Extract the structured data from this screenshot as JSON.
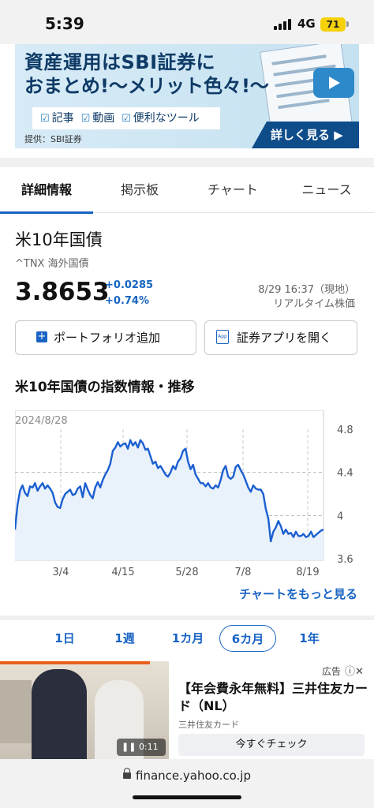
{
  "status_bar": {
    "time": "5:39",
    "network": "4G",
    "battery": "71"
  },
  "banner": {
    "line1": "資産運用はSBI証券に",
    "line2": "おまとめ!〜メリット色々!〜",
    "features": [
      "記事",
      "動画",
      "便利なツール"
    ],
    "cta": "詳しく見る ▶",
    "source": "提供：SBI証券"
  },
  "tabs": [
    "詳細情報",
    "掲示板",
    "チャート",
    "ニュース"
  ],
  "quote": {
    "name": "米10年国債",
    "symbol_line": "^TNX 海外国債",
    "price": "3.8653",
    "change": "+0.0285",
    "change_pct": "+0.74%",
    "timestamp": "8/29 16:37（現地）",
    "realtime": "リアルタイム株価"
  },
  "buttons": {
    "portfolio": "ポートフォリオ追加",
    "app": "証券アプリを開く"
  },
  "section_title": "米10年国債の指数情報・推移",
  "chart_data": {
    "type": "area",
    "start_label": "2024/8/28",
    "x_ticks": [
      "3/4",
      "4/15",
      "5/28",
      "7/8",
      "8/19"
    ],
    "y_ticks": [
      "4.8",
      "4.4",
      "4",
      "3.6"
    ],
    "ylim": [
      3.6,
      4.8
    ],
    "values": [
      3.87,
      4.1,
      4.23,
      4.28,
      4.21,
      4.18,
      4.27,
      4.26,
      4.3,
      4.23,
      4.27,
      4.3,
      4.25,
      4.28,
      4.25,
      4.21,
      4.12,
      4.08,
      4.07,
      4.15,
      4.2,
      4.22,
      4.24,
      4.19,
      4.2,
      4.25,
      4.27,
      4.17,
      4.3,
      4.24,
      4.19,
      4.16,
      4.26,
      4.31,
      4.26,
      4.33,
      4.38,
      4.42,
      4.48,
      4.6,
      4.63,
      4.68,
      4.64,
      4.66,
      4.67,
      4.62,
      4.7,
      4.65,
      4.68,
      4.63,
      4.7,
      4.67,
      4.61,
      4.62,
      4.55,
      4.48,
      4.5,
      4.44,
      4.46,
      4.42,
      4.38,
      4.36,
      4.4,
      4.46,
      4.43,
      4.5,
      4.53,
      4.6,
      4.62,
      4.5,
      4.43,
      4.47,
      4.38,
      4.34,
      4.3,
      4.3,
      4.27,
      4.3,
      4.26,
      4.25,
      4.28,
      4.26,
      4.33,
      4.42,
      4.46,
      4.36,
      4.34,
      4.36,
      4.45,
      4.47,
      4.42,
      4.38,
      4.32,
      4.26,
      4.22,
      4.28,
      4.25,
      4.24,
      4.24,
      4.2,
      4.06,
      3.97,
      3.76,
      3.85,
      3.89,
      3.95,
      3.9,
      3.83,
      3.87,
      3.83,
      3.84,
      3.8,
      3.85,
      3.81,
      3.81,
      3.83,
      3.8,
      3.81,
      3.85,
      3.8,
      3.82,
      3.84,
      3.86,
      3.87
    ],
    "grid": true,
    "line_color": "#1b5fd1",
    "fill_color": "#e9f1fa"
  },
  "chart_more": "チャートをもっと見る",
  "periods": [
    "1日",
    "1週",
    "1カ月",
    "6カ月",
    "1年"
  ],
  "selected_period": "6カ月",
  "ad": {
    "label": "広告",
    "title": "【年会費永年無料】三井住友カード（NL）",
    "brand": "三井住友カード",
    "button": "今すぐチェック",
    "video_time": "0:11"
  },
  "url": "finance.yahoo.co.jp"
}
